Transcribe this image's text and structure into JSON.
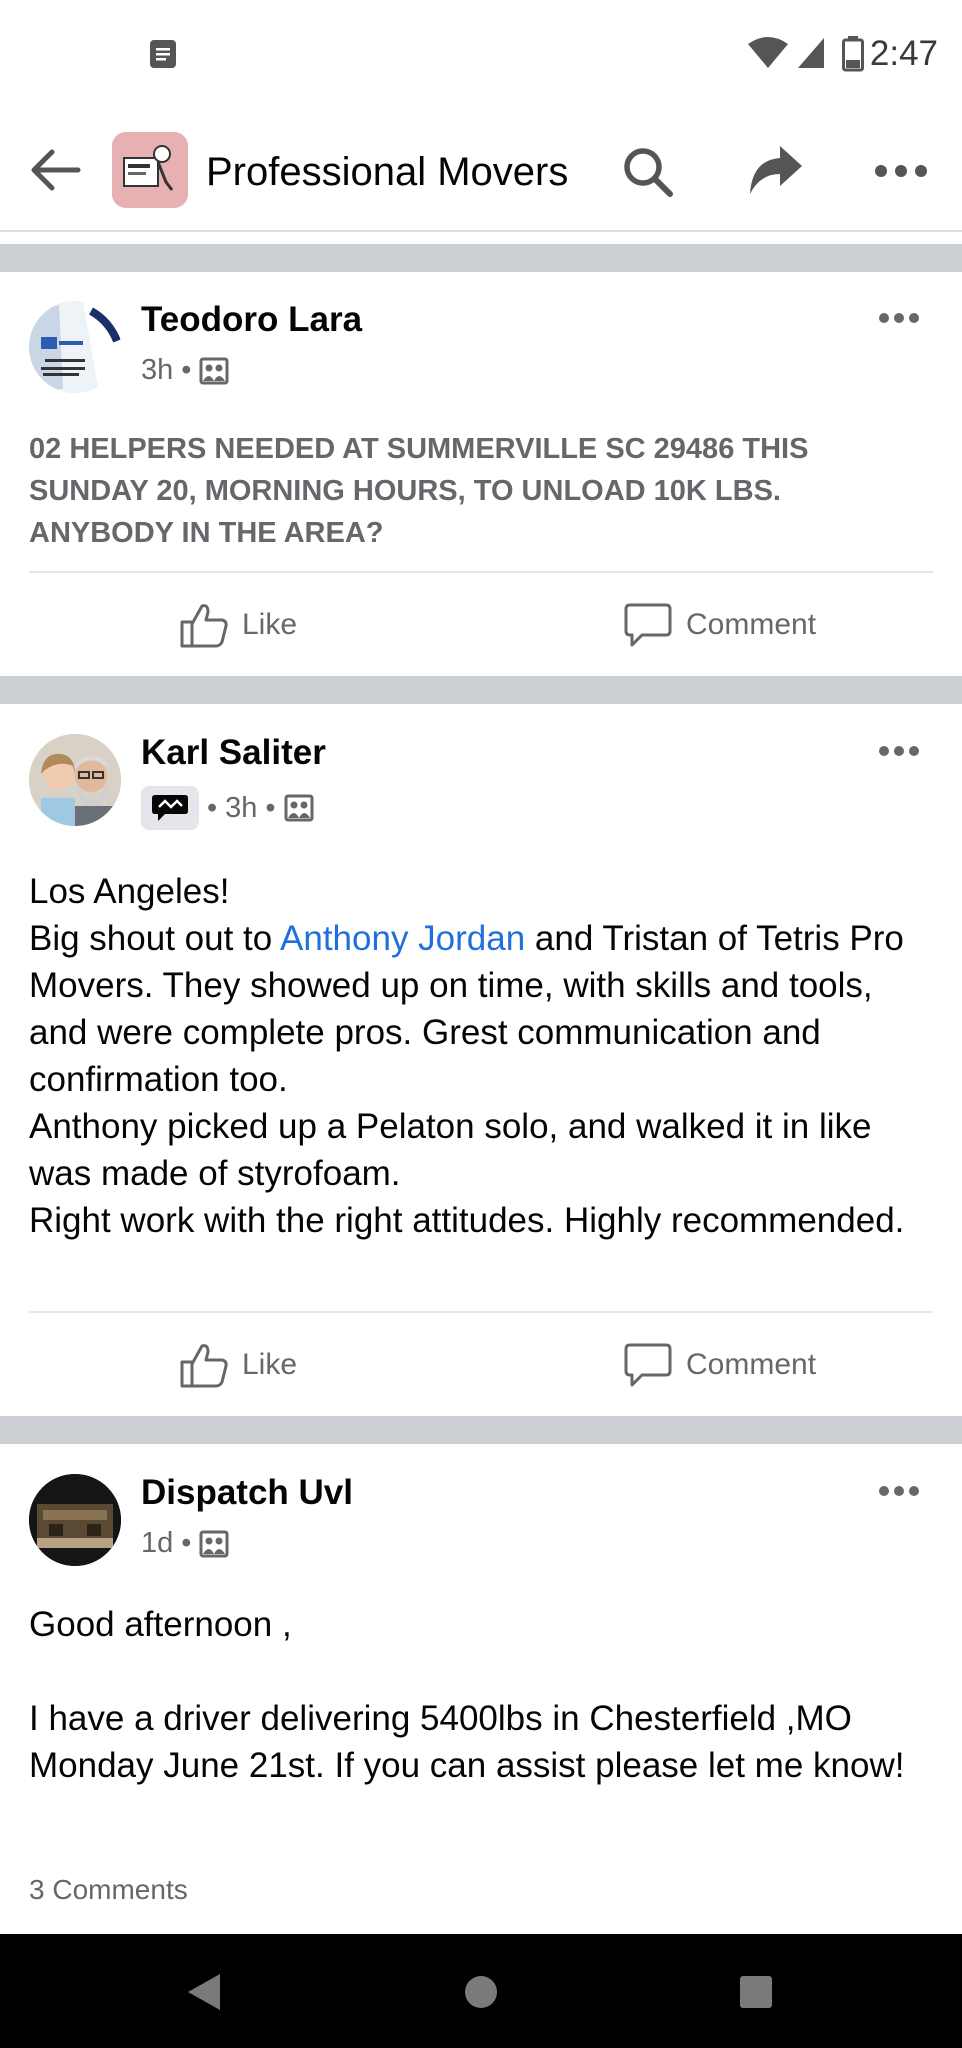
{
  "status_bar": {
    "time": "2:47"
  },
  "header": {
    "title": "Professional Movers"
  },
  "posts": [
    {
      "author": "Teodoro Lara",
      "time": "3h",
      "text": "02 HELPERS NEEDED AT SUMMERVILLE SC 29486 THIS SUNDAY 20, MORNING HOURS, TO UNLOAD 10K LBS. ANYBODY IN THE AREA?",
      "like_label": "Like",
      "comment_label": "Comment"
    },
    {
      "author": "Karl Saliter",
      "time": "3h",
      "text_line1": "Los Angeles!",
      "text_shout_pre": "Big shout out to ",
      "mention": "Anthony Jordan",
      "text_shout_post": " and Tristan of Tetris Pro Movers. They showed up on time, with skills and tools, and were complete pros. Grest communication and confirmation too.",
      "text_line3": "Anthony picked up a Pelaton solo, and walked it in like was made of styrofoam.",
      "text_line4": "Right work with the right attitudes. Highly recommended.",
      "like_label": "Like",
      "comment_label": "Comment"
    },
    {
      "author": "Dispatch Uvl",
      "time": "1d",
      "text_line1": "Good afternoon ,",
      "text_line2": "I have a driver delivering 5400lbs in Chesterfield ,MO Monday June 21st. If you can assist please let me know!",
      "comments_count": "3 Comments"
    }
  ],
  "separator": "•",
  "colors": {
    "mention": "#216fdb",
    "divider": "#ccd0d5",
    "secondary_text": "#65676b"
  }
}
